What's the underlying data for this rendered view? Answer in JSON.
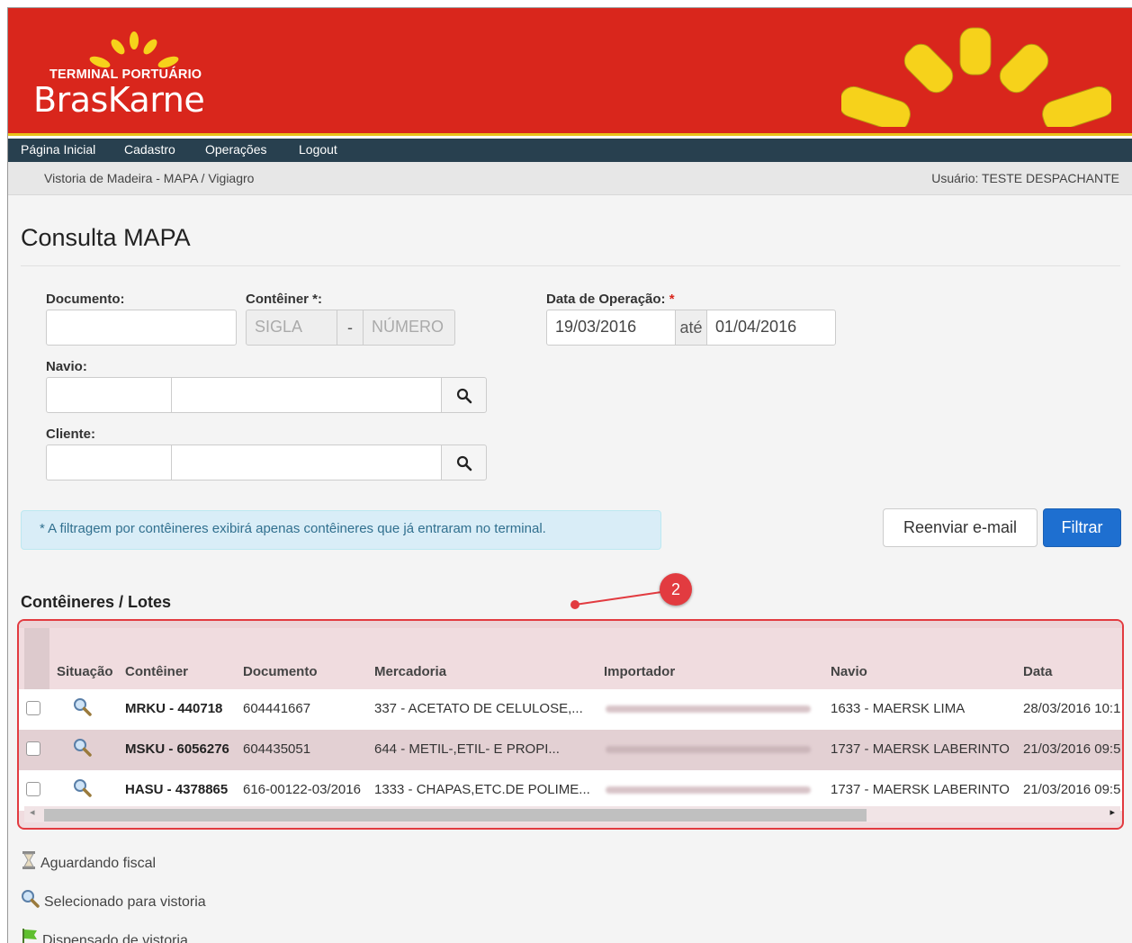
{
  "brand": {
    "small": "TERMINAL PORTUÁRIO",
    "big": "BrasKarne"
  },
  "nav": {
    "items": [
      "Página Inicial",
      "Cadastro",
      "Operações",
      "Logout"
    ]
  },
  "breadcrumb": "Vistoria de Madeira - MAPA / Vigiagro",
  "user": "Usuário: TESTE DESPACHANTE",
  "page_title": "Consulta MAPA",
  "form": {
    "documento_label": "Documento:",
    "conteiner_label": "Contêiner *:",
    "sigla_placeholder": "SIGLA",
    "dash": "-",
    "numero_placeholder": "NÚMERO",
    "data_label": "Data de Operação:",
    "data_req": "*",
    "date_from": "19/03/2016",
    "ate": "até",
    "date_to": "01/04/2016",
    "navio_label": "Navio:",
    "cliente_label": "Cliente:"
  },
  "alert": "* A filtragem por contêineres exibirá apenas contêineres que já entraram no terminal.",
  "buttons": {
    "resend": "Reenviar e-mail",
    "filter": "Filtrar"
  },
  "section_title": "Contêineres / Lotes",
  "annotation_badge": "2",
  "table": {
    "headers": [
      "Situação",
      "Contêiner",
      "Documento",
      "Mercadoria",
      "Importador",
      "Navio",
      "Data"
    ],
    "rows": [
      {
        "conteiner": "MRKU - 440718",
        "documento": "604441667",
        "mercadoria": "337 - ACETATO DE CELULOSE,...",
        "navio": "1633 - MAERSK LIMA",
        "data": "28/03/2016 10:1"
      },
      {
        "conteiner": "MSKU - 6056276",
        "documento": "604435051",
        "mercadoria": "644 - METIL-,ETIL- E PROPI...",
        "navio": "1737 - MAERSK LABERINTO",
        "data": "21/03/2016 09:5"
      },
      {
        "conteiner": "HASU - 4378865",
        "documento": "616-00122-03/2016",
        "mercadoria": "1333 - CHAPAS,ETC.DE POLIME...",
        "navio": "1737 - MAERSK LABERINTO",
        "data": "21/03/2016 09:5"
      }
    ]
  },
  "legend": [
    {
      "icon": "hourglass-icon",
      "label": "Aguardando fiscal"
    },
    {
      "icon": "magnifier-icon",
      "label": "Selecionado para vistoria"
    },
    {
      "icon": "flag-icon",
      "label": "Dispensado de vistoria"
    }
  ]
}
